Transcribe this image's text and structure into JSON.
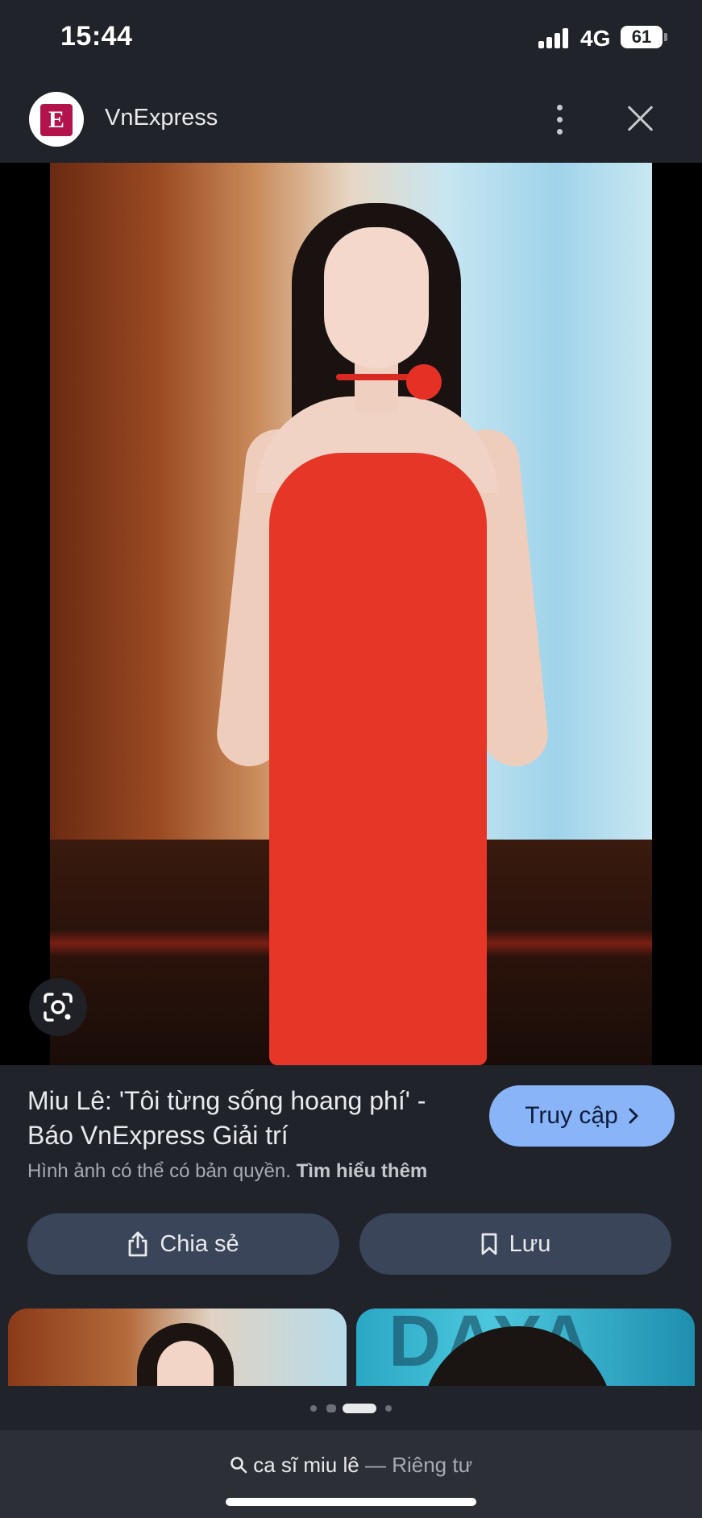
{
  "status_bar": {
    "time": "15:44",
    "network": "4G",
    "battery": "61"
  },
  "header": {
    "logo_letter": "E",
    "site_name": "VnExpress"
  },
  "result": {
    "title": "Miu Lê: 'Tôi từng sống hoang phí' - Báo VnExpress Giải trí",
    "copyright_note": "Hình ảnh có thể có bản quyền.",
    "learn_more": "Tìm hiểu thêm",
    "visit_label": "Truy cập"
  },
  "actions": {
    "share_label": "Chia sẻ",
    "save_label": "Lưu"
  },
  "related": {
    "thumb2_overlay_text": "DAYA"
  },
  "bottom": {
    "query": "ca sĩ miu lê",
    "separator": "—",
    "mode": "Riêng tư"
  },
  "colors": {
    "accent_button": "#8ab4f8",
    "action_button": "#3b4559",
    "background": "#20232a",
    "logo_red": "#b3134b"
  },
  "icons": [
    "signal-icon",
    "battery-icon",
    "more-vert-icon",
    "close-icon",
    "lens-icon",
    "chevron-right-icon",
    "share-icon",
    "bookmark-icon",
    "search-icon"
  ]
}
